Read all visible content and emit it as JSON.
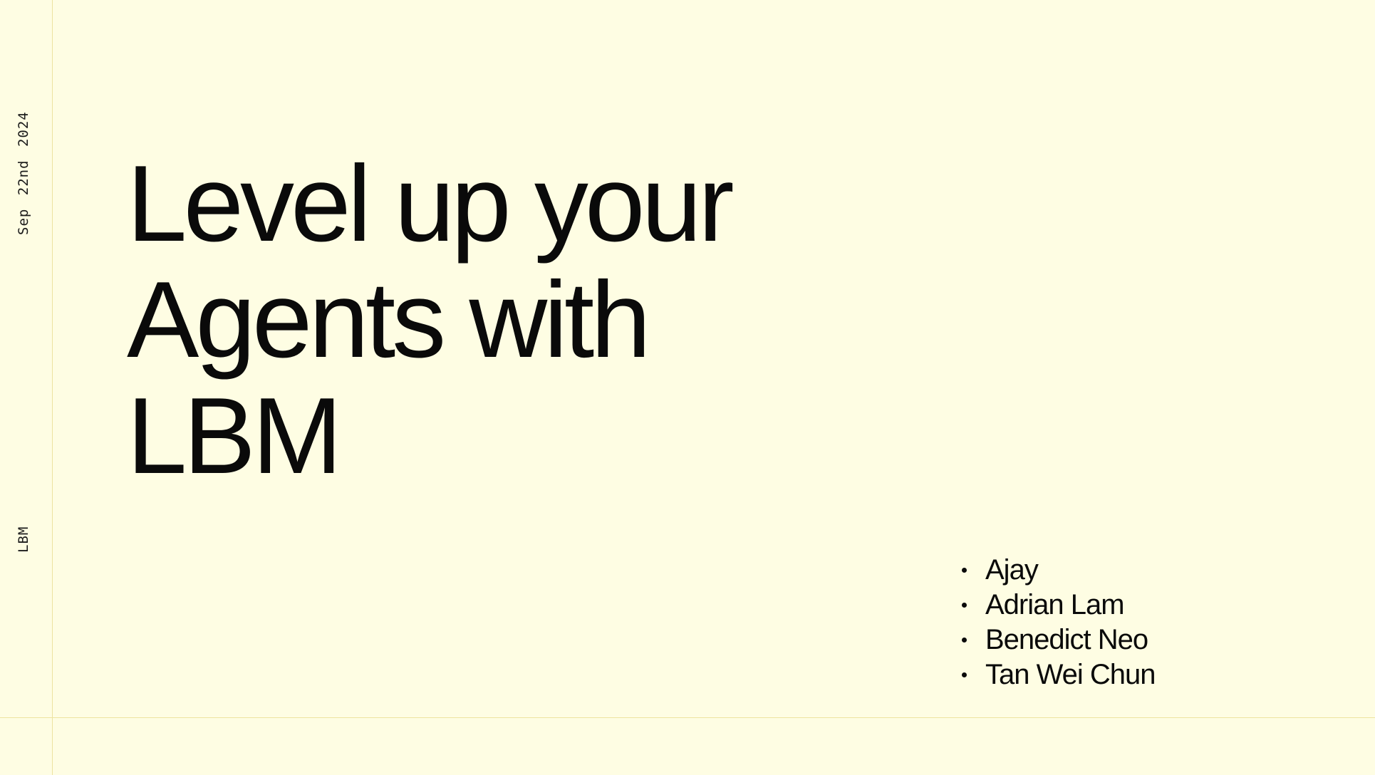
{
  "slide": {
    "date": "Sep 22nd 2024",
    "brand": "LBM",
    "title_lines": [
      "Level up your",
      "Agents with",
      "LBM"
    ],
    "authors": [
      "Ajay",
      "Adrian Lam",
      "Benedict Neo",
      "Tan Wei Chun"
    ]
  },
  "colors": {
    "background": "#FEFDE3",
    "rule": "#EDE3A0",
    "text": "#0a0a0a"
  }
}
